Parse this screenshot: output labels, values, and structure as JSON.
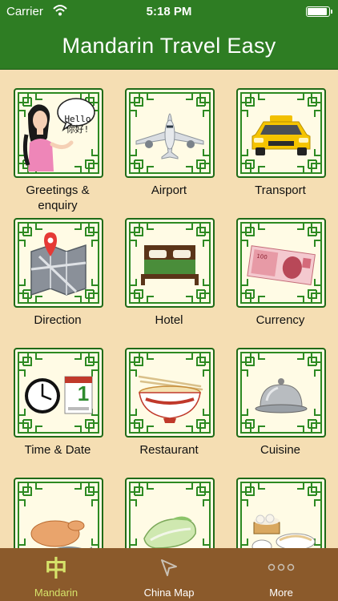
{
  "status_bar": {
    "carrier": "Carrier",
    "time": "5:18 PM"
  },
  "header": {
    "title": "Mandarin Travel Easy"
  },
  "categories": [
    {
      "label": "Greetings &\nenquiry",
      "speech": "Hello\n你好!",
      "icon": "woman-greeting-icon"
    },
    {
      "label": "Airport",
      "icon": "airplane-icon"
    },
    {
      "label": "Transport",
      "icon": "taxi-icon"
    },
    {
      "label": "Direction",
      "icon": "map-pin-icon"
    },
    {
      "label": "Hotel",
      "icon": "bed-icon"
    },
    {
      "label": "Currency",
      "icon": "banknote-icon"
    },
    {
      "label": "Time & Date",
      "calendar_day": "1",
      "icon": "clock-calendar-icon"
    },
    {
      "label": "Restaurant",
      "icon": "noodle-bowl-icon"
    },
    {
      "label": "Cuisine",
      "icon": "cloche-icon"
    },
    {
      "label": "",
      "icon": "chicken-fish-icon"
    },
    {
      "label": "",
      "icon": "cabbage-icon"
    },
    {
      "label": "",
      "icon": "dim-sum-icon"
    }
  ],
  "tabs": [
    {
      "label": "Mandarin",
      "glyph": "中",
      "icon": "zhong-character-icon",
      "active": true
    },
    {
      "label": "China Map",
      "icon": "location-arrow-icon",
      "active": false
    },
    {
      "label": "More",
      "glyph": "○○○",
      "icon": "more-dots-icon",
      "active": false
    }
  ],
  "colors": {
    "header_green": "#2e7d23",
    "background": "#f5deb3",
    "tab_bar": "#8b5a2b",
    "tab_active": "#d6e36a"
  }
}
